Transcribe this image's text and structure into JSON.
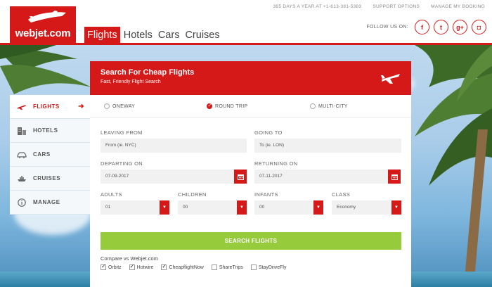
{
  "brand": {
    "logo_text": "webjet.com",
    "color": "#d51818"
  },
  "nav": {
    "tabs": [
      {
        "label": "Flights",
        "active": true
      },
      {
        "label": "Hotels"
      },
      {
        "label": "Cars"
      },
      {
        "label": "Cruises"
      }
    ]
  },
  "top_links": {
    "phone": "365 DAYS A YEAR AT +1-613-381-5383",
    "support": "SUPPORT OPTIONS",
    "booking": "MANAGE MY BOOKING"
  },
  "follow": {
    "label": "FOLLOW US ON:",
    "icons": [
      "facebook-icon",
      "twitter-icon",
      "google-plus-icon",
      "instagram-icon"
    ],
    "glyphs": [
      "f",
      "t",
      "g+",
      "◘"
    ]
  },
  "side_menu": {
    "items": [
      {
        "label": "FLIGHTS",
        "icon": "plane-icon",
        "active": true
      },
      {
        "label": "HOTELS",
        "icon": "hotel-icon"
      },
      {
        "label": "CARS",
        "icon": "car-icon"
      },
      {
        "label": "CRUISES",
        "icon": "ship-icon"
      },
      {
        "label": "MANAGE",
        "icon": "info-icon"
      }
    ],
    "arrow": "➜"
  },
  "panel": {
    "title": "Search For Cheap Flights",
    "subtitle": "Fast, Friendly Flight Search",
    "trip_types": [
      {
        "label": "ONEWAY",
        "checked": false
      },
      {
        "label": "ROUND TRIP",
        "checked": true
      },
      {
        "label": "MULTI-CITY",
        "checked": false
      }
    ],
    "leaving": {
      "label": "LEAVING FROM",
      "placeholder": "From (ie. NYC)"
    },
    "going": {
      "label": "GOING TO",
      "placeholder": "To (ie. LON)"
    },
    "departing": {
      "label": "DEPARTING ON",
      "value": "07-09-2017"
    },
    "returning": {
      "label": "RETURNING ON",
      "value": "07-11-2017"
    },
    "adults": {
      "label": "ADULTS",
      "value": "01"
    },
    "children": {
      "label": "CHILDREN",
      "value": "00"
    },
    "infants": {
      "label": "INFANTS",
      "value": "00"
    },
    "class": {
      "label": "CLASS",
      "value": "Economy"
    },
    "dropdown_glyph": "▼",
    "search_button": "SEARCH FLIGHTS",
    "compare_title": "Compare vs Webjet.com",
    "compare": [
      {
        "label": "Orbitz",
        "checked": true
      },
      {
        "label": "Hotwire",
        "checked": true
      },
      {
        "label": "CheapflightNow",
        "checked": true
      },
      {
        "label": "ShareTrips",
        "checked": false
      },
      {
        "label": "StayDriveFly",
        "checked": false
      }
    ]
  }
}
